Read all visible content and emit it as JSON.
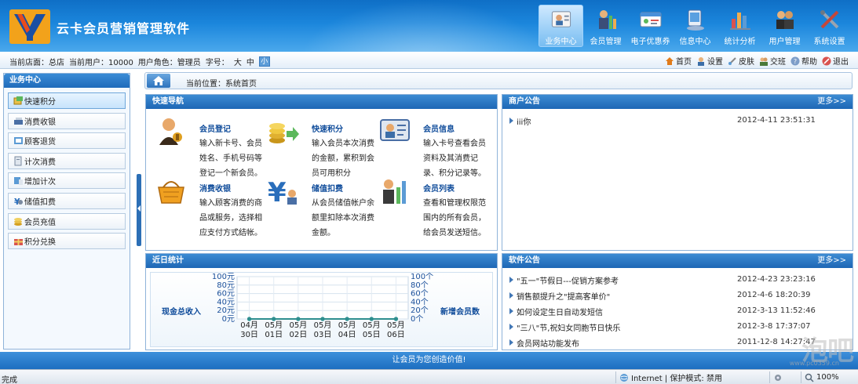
{
  "header": {
    "app_title": "云卡会员营销管理软件",
    "nav": [
      {
        "label": "业务中心",
        "icon": "business-center-icon",
        "active": true
      },
      {
        "label": "会员管理",
        "icon": "member-management-icon",
        "active": false
      },
      {
        "label": "电子优惠券",
        "icon": "e-coupon-icon",
        "active": false
      },
      {
        "label": "信息中心",
        "icon": "info-center-icon",
        "active": false
      },
      {
        "label": "统计分析",
        "icon": "statistics-icon",
        "active": false
      },
      {
        "label": "用户管理",
        "icon": "user-management-icon",
        "active": false
      },
      {
        "label": "系统设置",
        "icon": "system-settings-icon",
        "active": false
      }
    ]
  },
  "infobar": {
    "store": "当前店面：总店",
    "user": "当前用户：10000",
    "role": "用户角色：管理员",
    "font_label": "字号：",
    "font_large": "大",
    "font_medium": "中",
    "font_small": "小",
    "links": {
      "home": "首页",
      "settings": "设置",
      "skin": "皮肤",
      "shift": "交班",
      "help": "帮助",
      "logout": "退出"
    }
  },
  "sidebar": {
    "title": "业务中心",
    "items": [
      {
        "label": "快速积分",
        "active": true
      },
      {
        "label": "消费收银",
        "active": false
      },
      {
        "label": "顾客退货",
        "active": false
      },
      {
        "label": "计次消费",
        "active": false
      },
      {
        "label": "增加计次",
        "active": false
      },
      {
        "label": "储值扣费",
        "active": false
      },
      {
        "label": "会员充值",
        "active": false
      },
      {
        "label": "积分兑换",
        "active": false
      }
    ]
  },
  "breadcrumb": {
    "text": "当前位置：系统首页"
  },
  "quick_nav": {
    "title": "快速导航",
    "items": [
      {
        "title": "会员登记",
        "desc": "输入新卡号、会员姓名、手机号码等登记一个新会员。"
      },
      {
        "title": "快速积分",
        "desc": "输入会员本次消费的金额，累积到会员可用积分"
      },
      {
        "title": "会员信息",
        "desc": "输入卡号查看会员资料及其消费记录、积分记录等。"
      },
      {
        "title": "消费收银",
        "desc": "输入顾客消费的商品或服务，选择相应支付方式结帐。"
      },
      {
        "title": "储值扣费",
        "desc": "从会员储值帐户余额里扣除本次消费金额。"
      },
      {
        "title": "会员列表",
        "desc": "查看和管理权限范围内的所有会员，给会员发送短信。"
      }
    ]
  },
  "merchant_notice": {
    "title": "商户公告",
    "more": "更多>>",
    "items": [
      {
        "title": "iii你",
        "date": "2012-4-11 23:51:31"
      }
    ]
  },
  "stats": {
    "title": "近日统计",
    "left_label": "现金总收入",
    "right_label": "新增会员数"
  },
  "chart_data": {
    "type": "line",
    "title": "",
    "x_tick_lines": [
      [
        "04月",
        "30日"
      ],
      [
        "05月",
        "01日"
      ],
      [
        "05月",
        "02日"
      ],
      [
        "05月",
        "03日"
      ],
      [
        "05月",
        "04日"
      ],
      [
        "05月",
        "05日"
      ],
      [
        "05月",
        "06日"
      ]
    ],
    "categories": [
      "04月30日",
      "05月01日",
      "05月02日",
      "05月03日",
      "05月04日",
      "05月05日",
      "05月06日"
    ],
    "series": [
      {
        "axis": "left",
        "values": [
          0,
          0,
          0,
          0,
          0,
          0,
          0
        ]
      },
      {
        "axis": "right",
        "values": [
          0,
          0,
          0,
          0,
          0,
          0,
          0
        ]
      }
    ],
    "left_ticks": [
      "100元",
      "80元",
      "60元",
      "40元",
      "20元",
      "0元"
    ],
    "right_ticks": [
      "100个",
      "80个",
      "60个",
      "40个",
      "20个",
      "0个"
    ],
    "ylim": [
      0,
      100
    ],
    "colors": {
      "line": "#2f8f8f",
      "marker": "#2f8f8f"
    }
  },
  "software_notice": {
    "title": "软件公告",
    "more": "更多>>",
    "items": [
      {
        "title": "\"五一\"节假日---促销方案参考",
        "date": "2012-4-23 23:23:16"
      },
      {
        "title": "销售额提升之\"提高客单价\"",
        "date": "2012-4-6 18:20:39"
      },
      {
        "title": "如何设定生日自动发短信",
        "date": "2012-3-13 11:52:46"
      },
      {
        "title": "\"三八\"节,祝妇女同胞节日快乐",
        "date": "2012-3-8 17:37:07"
      },
      {
        "title": "会员网站功能发布",
        "date": "2011-12-8 14:27:47"
      }
    ]
  },
  "footer": {
    "slogan": "让会员为您创造价值!"
  },
  "statusbar": {
    "status": "完成",
    "zone": "Internet | 保护模式: 禁用",
    "zoom": "100%"
  },
  "watermark": {
    "text": "泡吧",
    "url": "www.pc0359.cn"
  }
}
